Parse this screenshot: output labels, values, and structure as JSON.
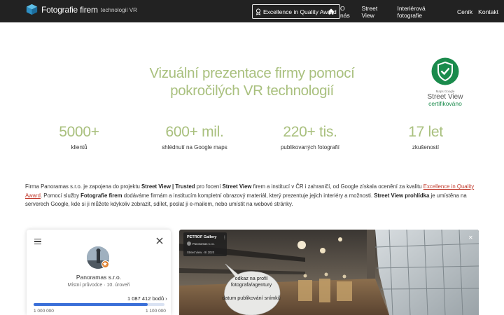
{
  "nav": {
    "brand": "Fotografie firem",
    "brand_sub": "technologií VR",
    "award_label": "Excellence in Quality Award",
    "links": [
      "O nás",
      "Street View",
      "Interiérová fotografie",
      "Ceník",
      "Kontakt"
    ]
  },
  "hero": {
    "title": "Vizuální prezentace firmy pomocí pokročilých VR technologií",
    "badge_maps": "Maps Google",
    "badge_sv": "Street View",
    "badge_cert": "certifikováno"
  },
  "stats": [
    {
      "value": "5000+",
      "label": "klientů"
    },
    {
      "value": "600+ mil.",
      "label": "shlédnutí na Google maps"
    },
    {
      "value": "220+ tis.",
      "label": "publikovaných fotografií"
    },
    {
      "value": "17 let",
      "label": "zkušeností"
    }
  ],
  "description": {
    "p1": "Firma Panoramas s.r.o. je zapojena do projektu ",
    "b1": "Street View | Trusted",
    "p2": " pro focení ",
    "b2": "Street View",
    "p3": " firem a institucí v ČR i zahraničí, od Google získala ocenění za kvalitu ",
    "link": "Excellence in Quality Award",
    "p4": ". Pomocí služby ",
    "b3": "Fotografie firem",
    "p5": " dodáváme firmám a institucím kompletní obrazový materiál, který prezentuje jejich interiéry a možnosti. ",
    "b4": "Street View prohlídka",
    "p6": " je umístěna na serverech Google, kde si ji můžete kdykoliv zobrazit, sdílet, poslat ji e-mailem, nebo umístit na webové stránky."
  },
  "profile_panel": {
    "name": "Panoramas s.r.o.",
    "subtitle": "Místní průvodce · 10. úroveň",
    "points": "1 087 412 bodů",
    "range_min": "1 000 000",
    "range_max": "1 100 000",
    "progress": 0.874
  },
  "street_view": {
    "card_title": "PETROF Gallery",
    "card_sub": "Panoramas s.r.o.",
    "card_date": "Street View · 9/ 2020",
    "bubble_1": "odkaz na profil fotografa/agentury",
    "bubble_2": "datum publikování snímků"
  },
  "colors": {
    "navbar": "#222222",
    "accent_green": "#a9c07e",
    "badge_green": "#1a8b4c",
    "link_red": "#c0392b",
    "progress_blue": "#3a6fd8"
  }
}
